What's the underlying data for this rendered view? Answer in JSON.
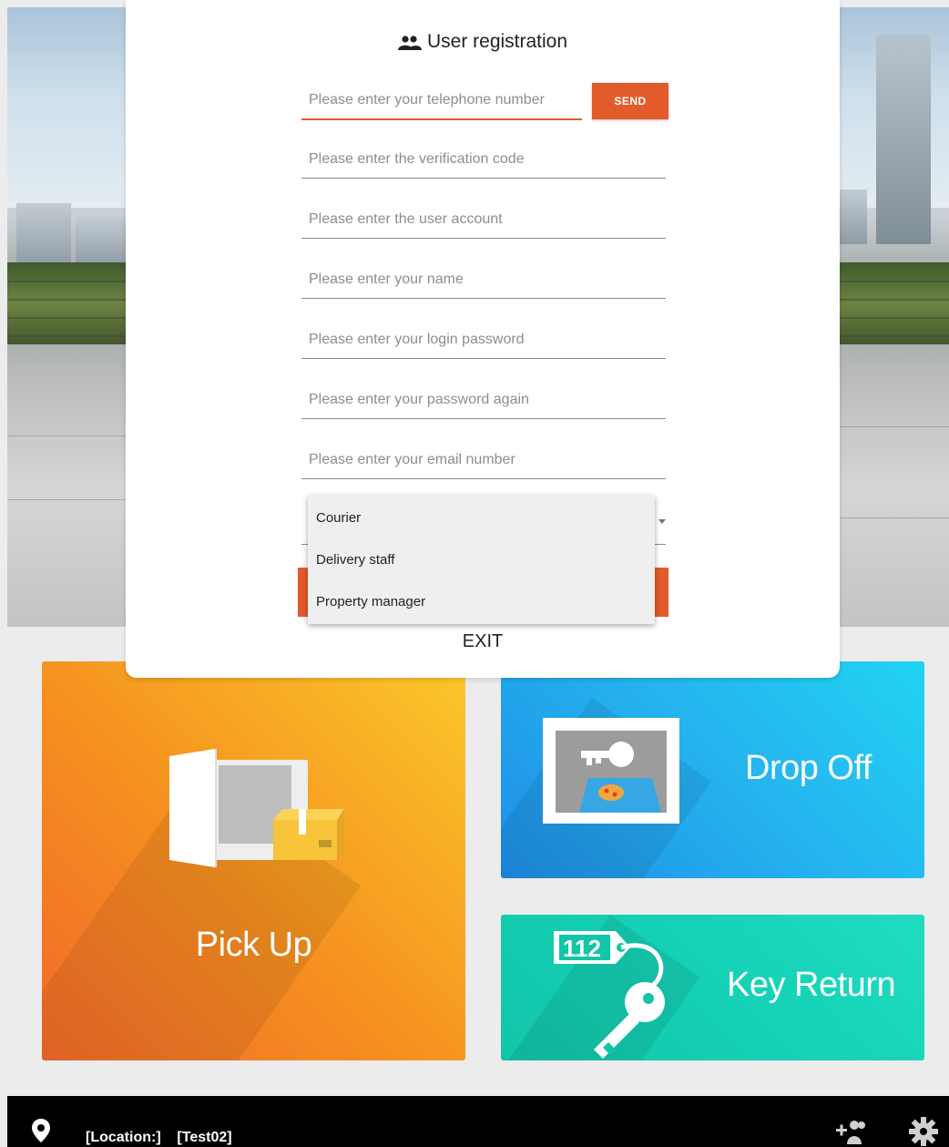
{
  "dialog": {
    "title": "User registration",
    "title_icon": "people-icon",
    "fields": {
      "phone": {
        "placeholder": "Please enter your telephone number",
        "value": ""
      },
      "code": {
        "placeholder": "Please enter the verification code",
        "value": ""
      },
      "account": {
        "placeholder": "Please enter the user account",
        "value": ""
      },
      "name": {
        "placeholder": "Please enter your name",
        "value": ""
      },
      "password": {
        "placeholder": "Please enter your login password",
        "value": ""
      },
      "password_again": {
        "placeholder": "Please enter your password again",
        "value": ""
      },
      "email": {
        "placeholder": "Please enter your email number",
        "value": ""
      }
    },
    "send_label": "SEND",
    "role_options": [
      "Courier",
      "Delivery staff",
      "Property manager"
    ],
    "exit_label": "EXIT",
    "accent_color": "#e35b2b"
  },
  "tiles": {
    "pick_up": {
      "label": "Pick Up",
      "icon": "locker-package-icon"
    },
    "drop_off": {
      "label": "Drop Off",
      "icon": "key-parcel-icon"
    },
    "key_return": {
      "label": "Key Return",
      "icon": "key-tag-icon",
      "tag_text": "112"
    }
  },
  "bottom_bar": {
    "location_icon": "location-pin-icon",
    "location_text": "[Location:]    [Test02]",
    "add_user_icon": "add-user-icon",
    "settings_icon": "gear-icon"
  }
}
